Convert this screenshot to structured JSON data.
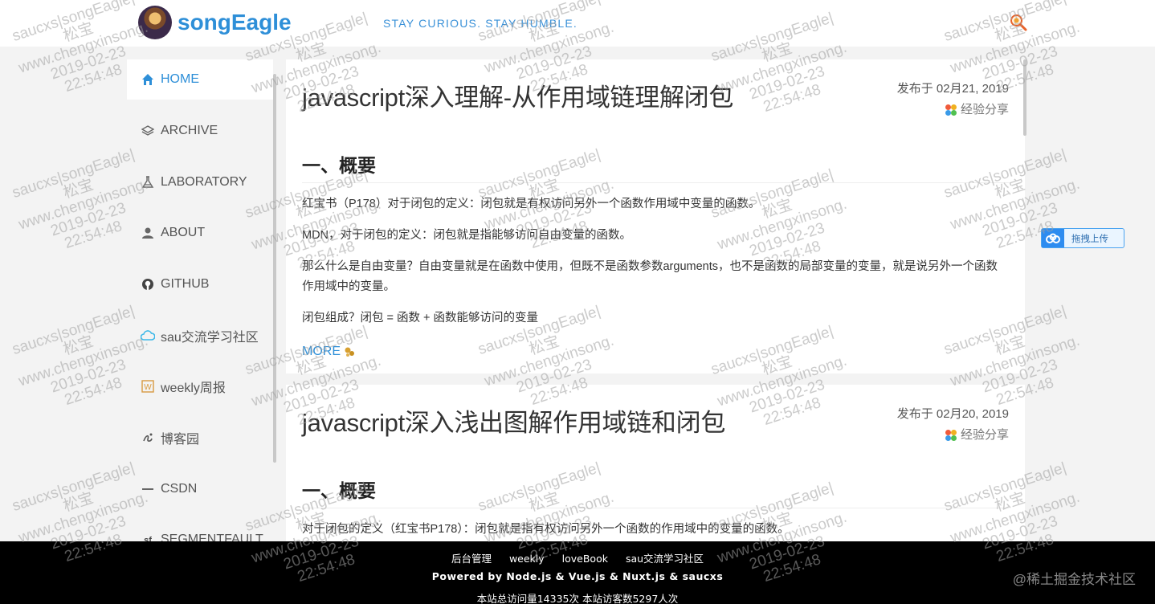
{
  "header": {
    "site_name": "songEagle",
    "slogan": "STAY CURIOUS. STAY HUMBLE."
  },
  "sidebar": {
    "items": [
      {
        "label": "HOME"
      },
      {
        "label": "ARCHIVE"
      },
      {
        "label": "LABORATORY"
      },
      {
        "label": "ABOUT"
      },
      {
        "label": "GITHUB"
      },
      {
        "label": "sau交流学习社区"
      },
      {
        "label": "weekly周报"
      },
      {
        "label": "博客园"
      },
      {
        "label": "CSDN"
      },
      {
        "label": "SEGMENTFAULT"
      }
    ]
  },
  "posts": [
    {
      "title": "javascript深入理解-从作用域链理解闭包",
      "date": "发布于 02月21, 2019",
      "category": "经验分享",
      "section": "一、概要",
      "paragraphs": [
        "红宝书（P178）对于闭包的定义：闭包就是有权访问另外一个函数作用域中变量的函数。",
        "MDN，对于闭包的定义：闭包就是指能够访问自由变量的函数。",
        "那么什么是自由变量？自由变量就是在函数中使用，但既不是函数参数arguments，也不是函数的局部变量的变量，就是说另外一个函数作用域中的变量。",
        "闭包组成？闭包 = 函数 + 函数能够访问的变量"
      ],
      "more": "MORE"
    },
    {
      "title": "javascript深入浅出图解作用域链和闭包",
      "date": "发布于 02月20, 2019",
      "category": "经验分享",
      "section": "一、概要",
      "paragraphs": [
        "对于闭包的定义（红宝书P178）：闭包就是指有权访问另外一个函数的作用域中的变量的函数。"
      ]
    }
  ],
  "upload": {
    "label": "拖拽上传"
  },
  "footer": {
    "links": [
      "后台管理",
      "weekly",
      "loveBook",
      "sau交流学习社区"
    ],
    "powered": "Powered by Node.js & Vue.js & Nuxt.js & saucxs",
    "visits": "本站总访问量14335次 本站访客数5297人次",
    "brand": "@稀土掘金技术社区"
  },
  "watermark": {
    "line1": "saucxs|songEagle|",
    "line2": "松宝",
    "line3": "www.chengxinsong.",
    "line4": "2019-02-23",
    "line5": "22:54:48"
  },
  "colors": {
    "accent": "#2e8fd8",
    "footer_bg": "#000000",
    "page_bg": "#f3f3f3"
  }
}
